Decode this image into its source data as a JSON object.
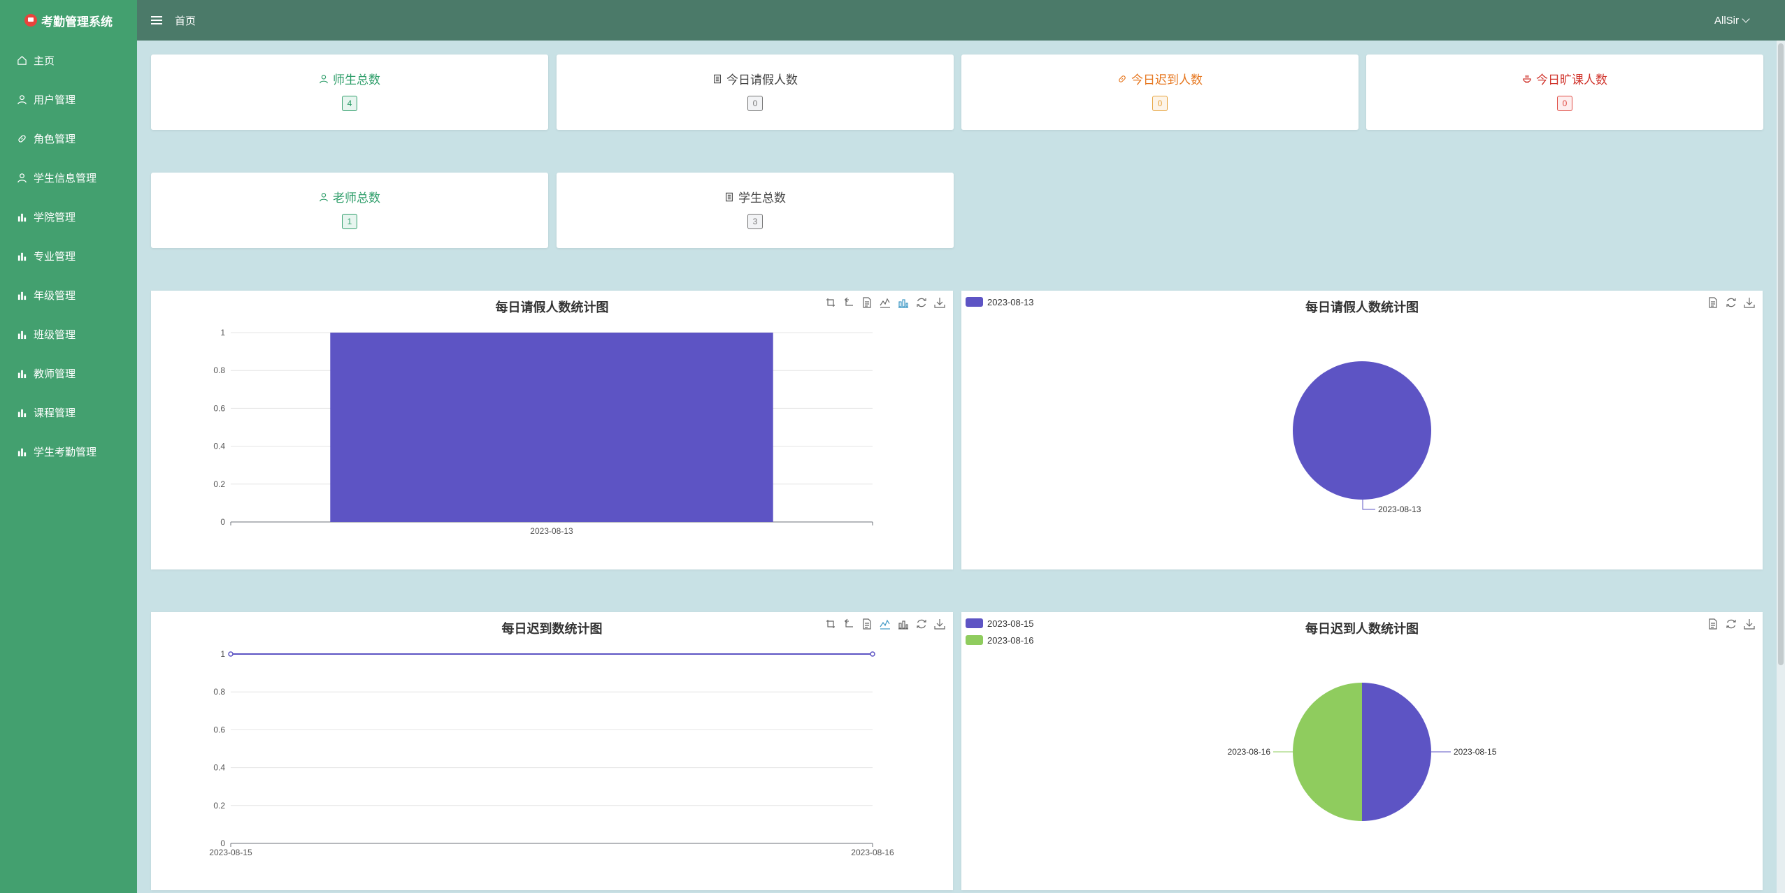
{
  "app": {
    "title": "考勤管理系统"
  },
  "header": {
    "breadcrumb": "首页",
    "user": "AllSir"
  },
  "sidebar": {
    "items": [
      {
        "label": "主页",
        "icon": "home-icon"
      },
      {
        "label": "用户管理",
        "icon": "user-icon"
      },
      {
        "label": "角色管理",
        "icon": "link-icon"
      },
      {
        "label": "学生信息管理",
        "icon": "user-icon"
      },
      {
        "label": "学院管理",
        "icon": "bar-chart-icon"
      },
      {
        "label": "专业管理",
        "icon": "bar-chart-icon"
      },
      {
        "label": "年级管理",
        "icon": "bar-chart-icon"
      },
      {
        "label": "班级管理",
        "icon": "bar-chart-icon"
      },
      {
        "label": "教师管理",
        "icon": "bar-chart-icon"
      },
      {
        "label": "课程管理",
        "icon": "bar-chart-icon"
      },
      {
        "label": "学生考勤管理",
        "icon": "bar-chart-icon"
      }
    ]
  },
  "stats": [
    {
      "label": "师生总数",
      "value": "4",
      "icon": "user-icon",
      "color": "#2f9e6a"
    },
    {
      "label": "今日请假人数",
      "value": "0",
      "icon": "document-icon",
      "color": "#444444"
    },
    {
      "label": "今日迟到人数",
      "value": "0",
      "icon": "link-icon",
      "color": "#e6761e"
    },
    {
      "label": "今日旷课人数",
      "value": "0",
      "icon": "bowl-icon",
      "color": "#d0342c"
    },
    {
      "label": "老师总数",
      "value": "1",
      "icon": "user-icon",
      "color": "#2f9e6a"
    },
    {
      "label": "学生总数",
      "value": "3",
      "icon": "document-icon",
      "color": "#444444"
    }
  ],
  "colors": {
    "series_purple": "#5d54c4",
    "series_green": "#8fcc5e"
  },
  "chart_data": [
    {
      "type": "bar",
      "title": "每日请假人数统计图",
      "categories": [
        "2023-08-13"
      ],
      "values": [
        1
      ],
      "ylim": [
        0,
        1
      ],
      "yticks": [
        "0",
        "0.2",
        "0.4",
        "0.6",
        "0.8",
        "1"
      ],
      "grid": true
    },
    {
      "type": "pie",
      "title": "每日请假人数统计图",
      "legend": [
        "2023-08-13"
      ],
      "legend_position": "top-left",
      "slices": [
        {
          "label": "2023-08-13",
          "value": 1
        }
      ]
    },
    {
      "type": "line",
      "title": "每日迟到数统计图",
      "x": [
        "2023-08-15",
        "2023-08-16"
      ],
      "values": [
        1,
        1
      ],
      "ylim": [
        0,
        1
      ],
      "yticks": [
        "0",
        "0.2",
        "0.4",
        "0.6",
        "0.8",
        "1"
      ],
      "grid": true
    },
    {
      "type": "pie",
      "title": "每日迟到人数统计图",
      "legend": [
        "2023-08-15",
        "2023-08-16"
      ],
      "legend_position": "top-left",
      "slices": [
        {
          "label": "2023-08-15",
          "value": 1
        },
        {
          "label": "2023-08-16",
          "value": 1
        }
      ]
    }
  ]
}
